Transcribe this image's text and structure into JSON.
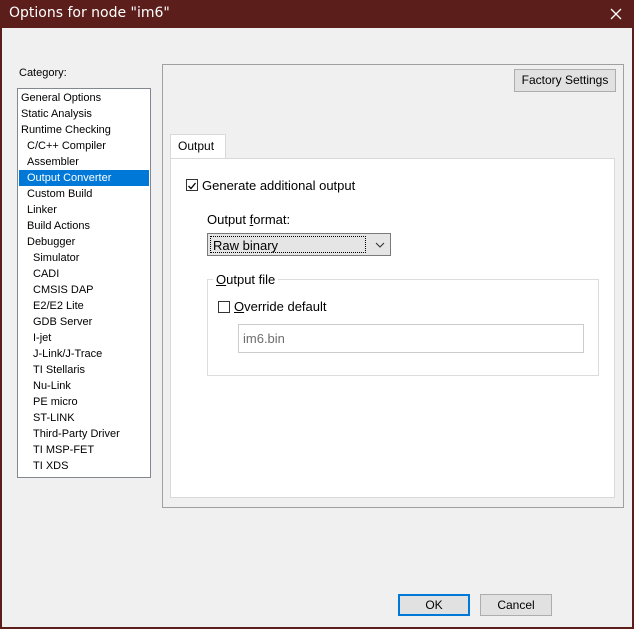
{
  "window": {
    "title": "Options for node \"im6\""
  },
  "category": {
    "label": "Category:",
    "items": [
      {
        "label": "General Options",
        "level": 0
      },
      {
        "label": "Static Analysis",
        "level": 0
      },
      {
        "label": "Runtime Checking",
        "level": 0
      },
      {
        "label": "C/C++ Compiler",
        "level": 1
      },
      {
        "label": "Assembler",
        "level": 1
      },
      {
        "label": "Output Converter",
        "level": 1,
        "selected": true
      },
      {
        "label": "Custom Build",
        "level": 1
      },
      {
        "label": "Linker",
        "level": 1
      },
      {
        "label": "Build Actions",
        "level": 1
      },
      {
        "label": "Debugger",
        "level": 1
      },
      {
        "label": "Simulator",
        "level": 2
      },
      {
        "label": "CADI",
        "level": 2
      },
      {
        "label": "CMSIS DAP",
        "level": 2
      },
      {
        "label": "E2/E2 Lite",
        "level": 2
      },
      {
        "label": "GDB Server",
        "level": 2
      },
      {
        "label": "I-jet",
        "level": 2
      },
      {
        "label": "J-Link/J-Trace",
        "level": 2
      },
      {
        "label": "TI Stellaris",
        "level": 2
      },
      {
        "label": "Nu-Link",
        "level": 2
      },
      {
        "label": "PE micro",
        "level": 2
      },
      {
        "label": "ST-LINK",
        "level": 2
      },
      {
        "label": "Third-Party Driver",
        "level": 2
      },
      {
        "label": "TI MSP-FET",
        "level": 2
      },
      {
        "label": "TI XDS",
        "level": 2
      }
    ]
  },
  "panel": {
    "factory_settings": "Factory Settings",
    "tab_label": "Output",
    "generate": {
      "label": "Generate additional output",
      "checked": true
    },
    "output_format": {
      "label_pre": "Output ",
      "label_mnemonic": "f",
      "label_post": "ormat:",
      "value": "Raw binary"
    },
    "output_file": {
      "group_pre": "",
      "group_mnemonic": "O",
      "group_post": "utput file",
      "override": {
        "pre": "",
        "mnemonic": "O",
        "post": "verride default",
        "checked": false
      },
      "value": "im6.bin"
    }
  },
  "buttons": {
    "ok": "OK",
    "cancel": "Cancel"
  },
  "colors": {
    "titlebar": "#5b1e1a",
    "selection": "#0078d7"
  }
}
